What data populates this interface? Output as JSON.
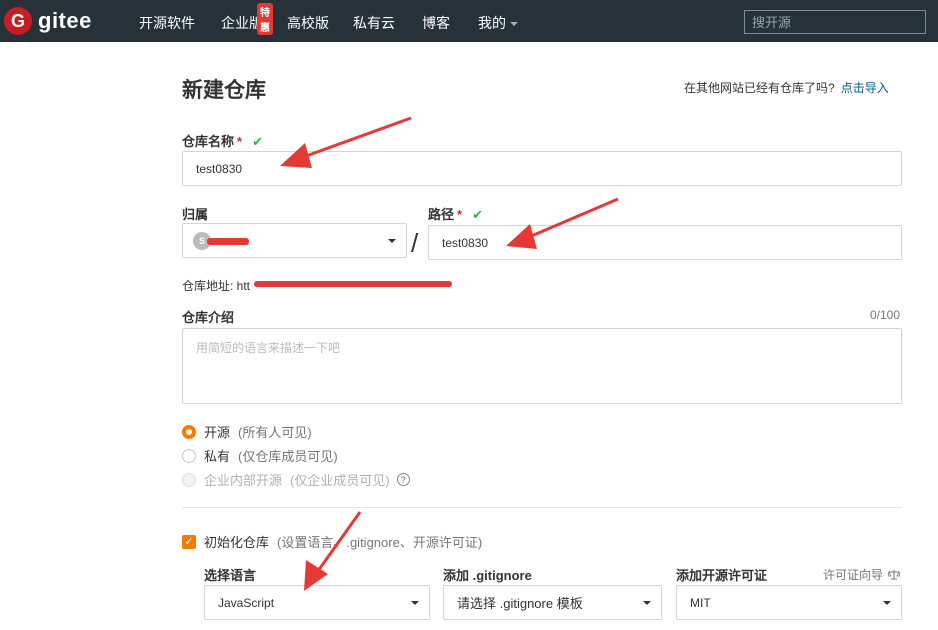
{
  "nav": {
    "logo_letter": "G",
    "logo_text": "gitee",
    "items": [
      "开源软件",
      "企业版",
      "高校版",
      "私有云",
      "博客",
      "我的"
    ],
    "badge": "特惠",
    "search_placeholder": "搜开源"
  },
  "page": {
    "title": "新建仓库",
    "import_tip": "在其他网站已经有仓库了吗?",
    "import_link": "点击导入"
  },
  "form": {
    "repo_name_label": "仓库名称",
    "required_mark": "*",
    "check_mark": "✔",
    "repo_name_value": "test0830",
    "owner_label": "归属",
    "owner_avatar": "S",
    "path_label": "路径",
    "path_value": "test0830",
    "slash": "/",
    "address_label": "仓库地址: ",
    "address_prefix": "htt",
    "intro_label": "仓库介绍",
    "intro_counter": "0/100",
    "intro_placeholder": "用简短的语言来描述一下吧",
    "visibility": [
      {
        "label": "开源",
        "hint": "(所有人可见)",
        "state": "on"
      },
      {
        "label": "私有",
        "hint": "(仅仓库成员可见)",
        "state": "off"
      },
      {
        "label": "企业内部开源",
        "hint": "(仅企业成员可见)",
        "state": "disabled"
      }
    ],
    "help_icon": "?",
    "init_label": "初始化仓库",
    "init_hint": "(设置语言、.gitignore、开源许可证)",
    "init_check": "✓",
    "lang_label": "选择语言",
    "lang_value": "JavaScript",
    "gitignore_label": "添加 .gitignore",
    "gitignore_value": "请选择 .gitignore 模板",
    "license_label": "添加开源许可证",
    "license_guide": "许可证向导",
    "license_value": "MIT"
  },
  "colors": {
    "navbar": "#263238",
    "brand_red": "#c71d23",
    "accent_orange": "#f57c00",
    "link": "#005980",
    "arrow_red": "#e53935"
  }
}
